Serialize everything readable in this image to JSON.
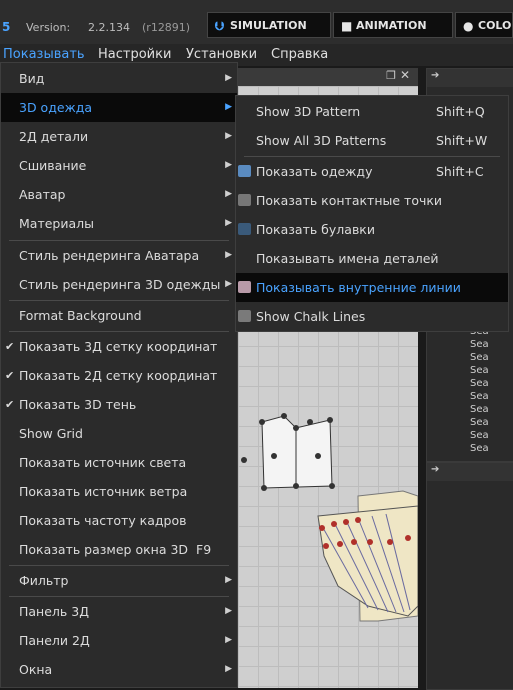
{
  "topbar": {
    "logo_num": "5",
    "version_label": "Version:",
    "version_value": "2.2.134",
    "build": "(r12891)",
    "modes": [
      {
        "label": "SIMULATION",
        "icon": "chevrons-down-icon"
      },
      {
        "label": "ANIMATION",
        "icon": "camera-icon"
      },
      {
        "label": "COLO",
        "icon": "palette-icon"
      }
    ]
  },
  "menubar": {
    "items": [
      "Показывать",
      "Настройки",
      "Установки",
      "Справка"
    ]
  },
  "main_menu": {
    "items": [
      {
        "label": "Вид",
        "submenu": true
      },
      {
        "label": "3D одежда",
        "submenu": true,
        "highlighted": true
      },
      {
        "label": "2Д детали",
        "submenu": true
      },
      {
        "label": "Сшивание",
        "submenu": true
      },
      {
        "label": "Аватар",
        "submenu": true
      },
      {
        "label": "Материалы",
        "submenu": true
      },
      {
        "label": "Стиль рендеринга Аватара",
        "submenu": true
      },
      {
        "label": "Стиль рендеринга 3D одежды",
        "submenu": true
      },
      {
        "label": "Format Background"
      },
      {
        "label": "Показать 3Д сетку координат",
        "checked": true
      },
      {
        "label": "Показать 2Д сетку координат",
        "checked": true
      },
      {
        "label": "Показать 3D тень",
        "checked": true
      },
      {
        "label": "Show Grid"
      },
      {
        "label": "Показать источник света"
      },
      {
        "label": "Показать источник ветра"
      },
      {
        "label": "Показать частоту кадров"
      },
      {
        "label": "Показать размер окна 3D",
        "shortcut": "F9"
      },
      {
        "label": "Фильтр",
        "submenu": true
      },
      {
        "label": "Панель 3Д",
        "submenu": true
      },
      {
        "label": "Панели 2Д",
        "submenu": true
      },
      {
        "label": "Окна",
        "submenu": true
      }
    ]
  },
  "submenu": {
    "items": [
      {
        "label": "Show 3D Pattern",
        "shortcut": "Shift+Q"
      },
      {
        "label": "Show All 3D Patterns",
        "shortcut": "Shift+W"
      },
      {
        "label": "Показать одежду",
        "shortcut": "Shift+C",
        "icon": "shirt-icon"
      },
      {
        "label": "Показать контактные точки",
        "icon": "contact-points-icon"
      },
      {
        "label": "Показать булавки",
        "icon": "pin-icon"
      },
      {
        "label": "Показывать имена деталей"
      },
      {
        "label": "Показывать внутренние линии",
        "icon": "inner-lines-icon",
        "highlighted": true
      },
      {
        "label": "Show Chalk Lines",
        "icon": "chalk-lines-icon"
      }
    ]
  },
  "tree": {
    "items": [
      "Sea",
      "Sea",
      "Sea",
      "Sea",
      "Sea",
      "Sea",
      "Sea",
      "Sea",
      "Sea",
      "Sea"
    ]
  },
  "colors": {
    "accent": "#4aa3ff",
    "highlight_bg": "#0a0a0a",
    "garment": "#efe6c5",
    "point_red": "#b0302a"
  }
}
